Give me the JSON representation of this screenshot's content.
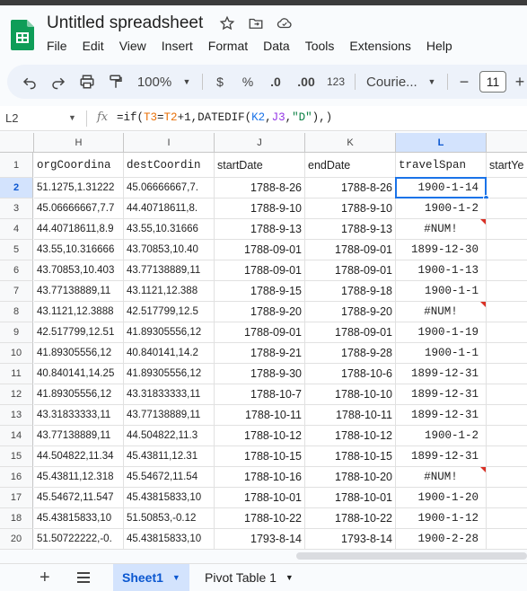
{
  "app": {
    "doc_title": "Untitled spreadsheet",
    "menu": [
      "File",
      "Edit",
      "View",
      "Insert",
      "Format",
      "Data",
      "Tools",
      "Extensions",
      "Help"
    ]
  },
  "toolbar": {
    "zoom": "100%",
    "currency": "$",
    "percent": "%",
    "dec_decrease": ".0",
    "dec_increase": ".00",
    "number_format": "123",
    "font": "Courie...",
    "font_size": "11",
    "minus": "−",
    "plus": "+"
  },
  "formula_bar": {
    "cell_ref": "L2",
    "fx": "fx",
    "formula_parts": [
      "=if(",
      "T3",
      "=",
      "T2",
      "+1,DATEDIF(",
      "K2",
      ",",
      "J3",
      ",",
      "\"D\"",
      "),)"
    ]
  },
  "grid": {
    "columns": [
      "H",
      "I",
      "J",
      "K",
      "L"
    ],
    "rows": [
      {
        "num": "1",
        "cells": [
          "orgCoordina",
          "destCoordin",
          "startDate",
          "endDate",
          "travelSpan",
          "startYe"
        ]
      },
      {
        "num": "2",
        "cells": [
          "51.1275,1.31222",
          "45.06666667,7.",
          "1788-8-26",
          "1788-8-26",
          "1900-1-14",
          ""
        ]
      },
      {
        "num": "3",
        "cells": [
          "45.06666667,7.7",
          "44.40718611,8.",
          "1788-9-10",
          "1788-9-10",
          "1900-1-2",
          ""
        ]
      },
      {
        "num": "4",
        "cells": [
          "44.40718611,8.9",
          "43.55,10.31666",
          "1788-9-13",
          "1788-9-13",
          "#NUM!",
          ""
        ]
      },
      {
        "num": "5",
        "cells": [
          "43.55,10.316666",
          "43.70853,10.40",
          "1788-09-01",
          "1788-09-01",
          "1899-12-30",
          ""
        ]
      },
      {
        "num": "6",
        "cells": [
          "43.70853,10.403",
          "43.77138889,11",
          "1788-09-01",
          "1788-09-01",
          "1900-1-13",
          ""
        ]
      },
      {
        "num": "7",
        "cells": [
          "43.77138889,11",
          "43.1121,12.388",
          "1788-9-15",
          "1788-9-18",
          "1900-1-1",
          ""
        ]
      },
      {
        "num": "8",
        "cells": [
          "43.1121,12.3888",
          "42.517799,12.5",
          "1788-9-20",
          "1788-9-20",
          "#NUM!",
          ""
        ]
      },
      {
        "num": "9",
        "cells": [
          "42.517799,12.51",
          "41.89305556,12",
          "1788-09-01",
          "1788-09-01",
          "1900-1-19",
          ""
        ]
      },
      {
        "num": "10",
        "cells": [
          "41.89305556,12",
          "40.840141,14.2",
          "1788-9-21",
          "1788-9-28",
          "1900-1-1",
          ""
        ]
      },
      {
        "num": "11",
        "cells": [
          "40.840141,14.25",
          "41.89305556,12",
          "1788-9-30",
          "1788-10-6",
          "1899-12-31",
          ""
        ]
      },
      {
        "num": "12",
        "cells": [
          "41.89305556,12",
          "43.31833333,11",
          "1788-10-7",
          "1788-10-10",
          "1899-12-31",
          ""
        ]
      },
      {
        "num": "13",
        "cells": [
          "43.31833333,11",
          "43.77138889,11",
          "1788-10-11",
          "1788-10-11",
          "1899-12-31",
          ""
        ]
      },
      {
        "num": "14",
        "cells": [
          "43.77138889,11",
          "44.504822,11.3",
          "1788-10-12",
          "1788-10-12",
          "1900-1-2",
          ""
        ]
      },
      {
        "num": "15",
        "cells": [
          "44.504822,11.34",
          "45.43811,12.31",
          "1788-10-15",
          "1788-10-15",
          "1899-12-31",
          ""
        ]
      },
      {
        "num": "16",
        "cells": [
          "45.43811,12.318",
          "45.54672,11.54",
          "1788-10-16",
          "1788-10-20",
          "#NUM!",
          ""
        ]
      },
      {
        "num": "17",
        "cells": [
          "45.54672,11.547",
          "45.43815833,10",
          "1788-10-01",
          "1788-10-01",
          "1900-1-20",
          ""
        ]
      },
      {
        "num": "18",
        "cells": [
          "45.43815833,10",
          "51.50853,-0.12",
          "1788-10-22",
          "1788-10-22",
          "1900-1-12",
          ""
        ]
      },
      {
        "num": "20",
        "cells": [
          "51.50722222,-0.",
          "45.43815833,10",
          "1793-8-14",
          "1793-8-14",
          "1900-2-28",
          ""
        ]
      }
    ],
    "comment_rows": [
      "4",
      "8",
      "16"
    ]
  },
  "sheets": {
    "tabs": [
      "Sheet1",
      "Pivot Table 1"
    ]
  },
  "colors": {
    "accent": "#1a73e8",
    "selected_header": "#d3e3fd",
    "sheets_green": "#0f9d58"
  }
}
